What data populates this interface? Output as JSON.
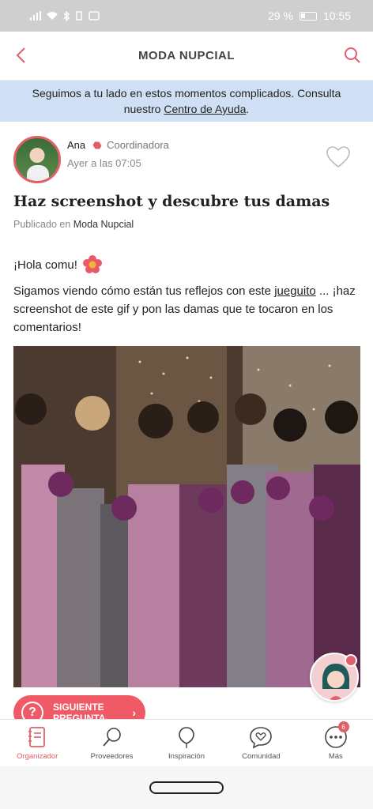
{
  "status": {
    "battery_pct": "29 %",
    "time": "10:55"
  },
  "appbar": {
    "title": "MODA NUPCIAL"
  },
  "banner": {
    "text_before": "Seguimos a tu lado en estos momentos complicados. Consulta nuestro ",
    "link": "Centro de Ayuda",
    "text_after": "."
  },
  "post": {
    "author_name": "Ana",
    "author_role": "Coordinadora",
    "time": "Ayer a las 07:05",
    "title": "Haz screenshot y descubre tus damas",
    "published_prefix": "Publicado en",
    "category": "Moda Nupcial",
    "greeting": "¡Hola comu!",
    "body_before": "Sigamos viendo cómo están tus reflejos con este ",
    "body_link": "jueguito",
    "body_after": " ... ¡haz screenshot de este gif y pon las damas que te tocaron en los comentarios!"
  },
  "next_button": {
    "line1": "SIGUIENTE",
    "line2": "PREGUNTA"
  },
  "tabs": [
    {
      "label": "Organizador",
      "icon": "organizer-icon",
      "active": true
    },
    {
      "label": "Proveedores",
      "icon": "vendors-icon",
      "active": false
    },
    {
      "label": "Inspiración",
      "icon": "inspiration-icon",
      "active": false
    },
    {
      "label": "Comunidad",
      "icon": "community-icon",
      "active": false
    },
    {
      "label": "Más",
      "icon": "more-icon",
      "active": false,
      "badge": "6"
    }
  ],
  "colors": {
    "accent": "#e0606a",
    "banner": "#cfe0f4"
  }
}
